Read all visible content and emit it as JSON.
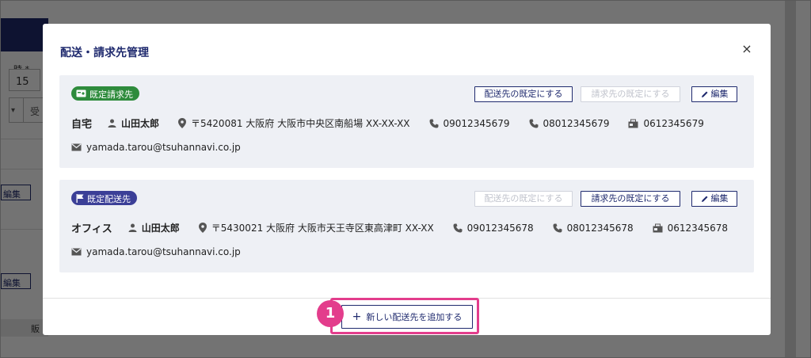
{
  "background": {
    "time_label": "時 *",
    "time_value": "15",
    "select_value": "受",
    "edit_label": "編集",
    "table_head": "販"
  },
  "modal": {
    "title": "配送・請求先管理",
    "close_label": "×",
    "cards": [
      {
        "badge": "既定請求先",
        "badge_color": "#2e8b3c",
        "btn_set_shipping": "配送先の既定にする",
        "btn_set_billing": "請求先の既定にする",
        "btn_edit": "編集",
        "place": "自宅",
        "name": "山田太郎",
        "address": "〒5420081 大阪府 大阪市中央区南船場 XX-XX-XX",
        "phone1": "09012345679",
        "phone2": "08012345679",
        "fax": "0612345679",
        "email": "yamada.tarou@tsuhannavi.co.jp"
      },
      {
        "badge": "既定配送先",
        "badge_color": "#3b3f97",
        "btn_set_shipping": "配送先の既定にする",
        "btn_set_billing": "請求先の既定にする",
        "btn_edit": "編集",
        "place": "オフィス",
        "name": "山田太郎",
        "address": "〒5430021 大阪府 大阪市天王寺区東高津町 XX-XX",
        "phone1": "09012345678",
        "phone2": "08012345678",
        "fax": "0612345678",
        "email": "yamada.tarou@tsuhannavi.co.jp"
      }
    ],
    "add_button": "新しい配送先を追加する",
    "step_number": "1"
  },
  "colors": {
    "navy": "#1f2a6e",
    "highlight": "#e33d8c"
  }
}
